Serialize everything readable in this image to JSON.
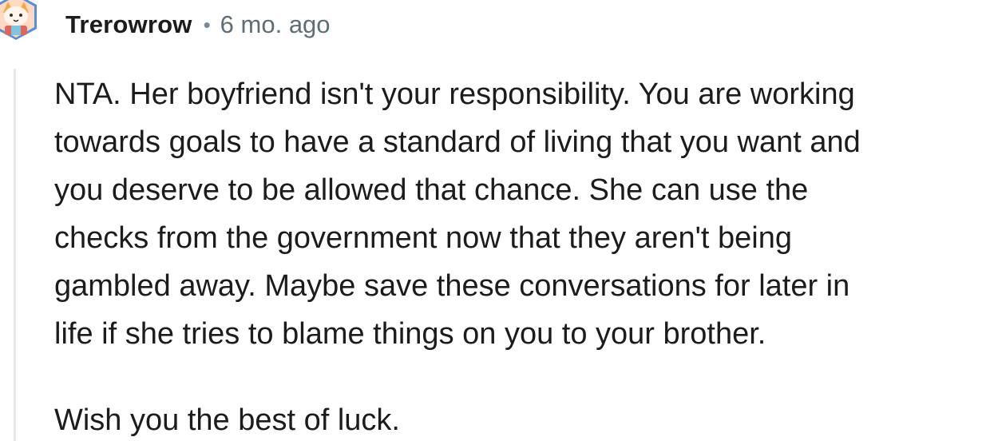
{
  "comment": {
    "avatar_icon": "snoo-avatar-icon",
    "username": "Trerowrow",
    "separator": "•",
    "timestamp": "6 mo. ago",
    "body_lines": [
      "NTA. Her boyfriend isn't your responsibility. You are working",
      "towards goals to have a standard of living that you want and",
      "you deserve to be allowed that chance. She can use the",
      "checks from the government now that they aren't being",
      "gambled away. Maybe save these conversations for later in",
      "life if she tries to blame things on you to your brother."
    ],
    "signoff": "Wish you the best of luck."
  },
  "colors": {
    "text": "#1c1c1c",
    "meta": "#5f6d74",
    "thread_line": "#e6e9eb"
  }
}
